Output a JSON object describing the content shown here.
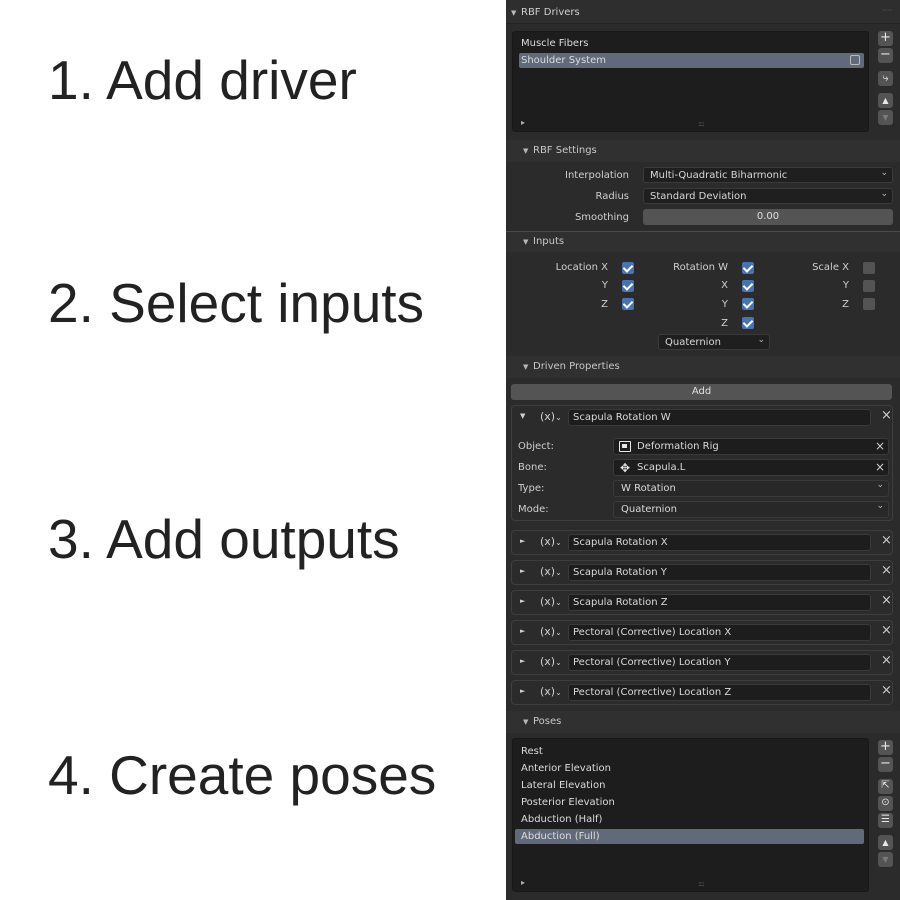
{
  "steps": [
    "1. Add driver",
    "2. Select inputs",
    "3. Add outputs",
    "4. Create poses"
  ],
  "panel": {
    "title": "RBF Drivers",
    "menu_dots": "····",
    "drivers": {
      "items": [
        "Muscle Fibers",
        "Shoulder System"
      ],
      "selected_index": 1
    },
    "side_buttons": {
      "add": "+",
      "remove": "−",
      "up": "▲",
      "down": "▼"
    },
    "grip": "::::",
    "expand": "▸",
    "rbf_settings": {
      "title": "RBF Settings",
      "interpolation_label": "Interpolation",
      "interpolation_value": "Multi-Quadratic Biharmonic",
      "radius_label": "Radius",
      "radius_value": "Standard Deviation",
      "smoothing_label": "Smoothing",
      "smoothing_value": "0.00"
    },
    "inputs": {
      "title": "Inputs",
      "location": [
        {
          "label": "Location X",
          "checked": true
        },
        {
          "label": "Y",
          "checked": true
        },
        {
          "label": "Z",
          "checked": true
        }
      ],
      "rotation": [
        {
          "label": "Rotation W",
          "checked": true
        },
        {
          "label": "X",
          "checked": true
        },
        {
          "label": "Y",
          "checked": true
        },
        {
          "label": "Z",
          "checked": true
        }
      ],
      "scale": [
        {
          "label": "Scale X",
          "checked": false
        },
        {
          "label": "Y",
          "checked": false
        },
        {
          "label": "Z",
          "checked": false
        }
      ],
      "rotation_mode": "Quaternion"
    },
    "driven": {
      "title": "Driven Properties",
      "add_label": "Add",
      "fx_label": "(x)",
      "close": "×",
      "expanded": {
        "name": "Scapula Rotation W",
        "object_label": "Object:",
        "object_value": "Deformation Rig",
        "bone_label": "Bone:",
        "bone_value": "Scapula.L",
        "type_label": "Type:",
        "type_value": "W Rotation",
        "mode_label": "Mode:",
        "mode_value": "Quaternion"
      },
      "collapsed": [
        "Scapula Rotation X",
        "Scapula Rotation Y",
        "Scapula Rotation Z",
        "Pectoral (Corrective) Location X",
        "Pectoral (Corrective) Location Y",
        "Pectoral (Corrective) Location Z"
      ]
    },
    "poses": {
      "title": "Poses",
      "items": [
        "Rest",
        "Anterior Elevation",
        "Lateral Elevation",
        "Posterior Elevation",
        "Abduction (Half)",
        "Abduction (Full)"
      ],
      "selected_index": 5
    }
  }
}
